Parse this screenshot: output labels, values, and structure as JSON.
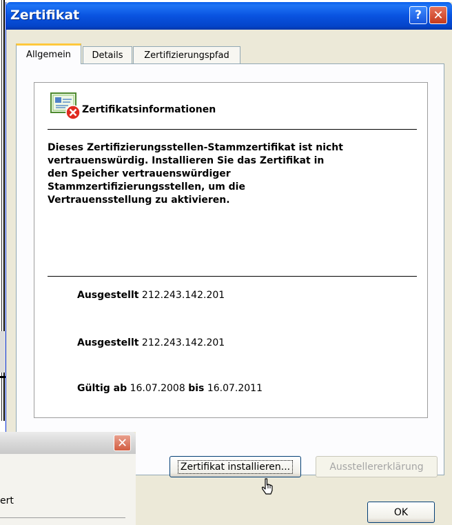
{
  "dialog": {
    "title": "Zertifikat",
    "help_button": "?",
    "close_button": "✕"
  },
  "tabs": [
    {
      "label": "Allgemein",
      "selected": true
    },
    {
      "label": "Details",
      "selected": false
    },
    {
      "label": "Zertifizierungspfad",
      "selected": false
    }
  ],
  "info": {
    "section_title": "Zertifikatsinformationen",
    "warning_lines": [
      "Dieses Zertifizierungsstellen-Stammzertifikat ist nicht",
      "vertrauenswürdig. Installieren Sie das Zertifikat in",
      "den Speicher vertrauenswürdiger",
      "Stammzertifizierungsstellen, um die",
      "Vertrauensstellung zu aktivieren."
    ],
    "issued_to_label": "Ausgestellt",
    "issued_to_value": "212.243.142.201",
    "issued_by_label": "Ausgestellt",
    "issued_by_value": "212.243.142.201",
    "valid_from_label": "Gültig ab",
    "valid_from_value": "16.07.2008",
    "valid_to_label": "bis",
    "valid_to_value": "16.07.2011"
  },
  "buttons": {
    "install": "Zertifikat installieren...",
    "issuer_statement": "Ausstellererklärung",
    "ok": "OK"
  },
  "background_dialog": {
    "close_button": "✕",
    "partial_text": "ert"
  },
  "colors": {
    "titlebar": "#0953e0",
    "dialog_face": "#ece9d8",
    "close_red": "#c63a1c"
  }
}
